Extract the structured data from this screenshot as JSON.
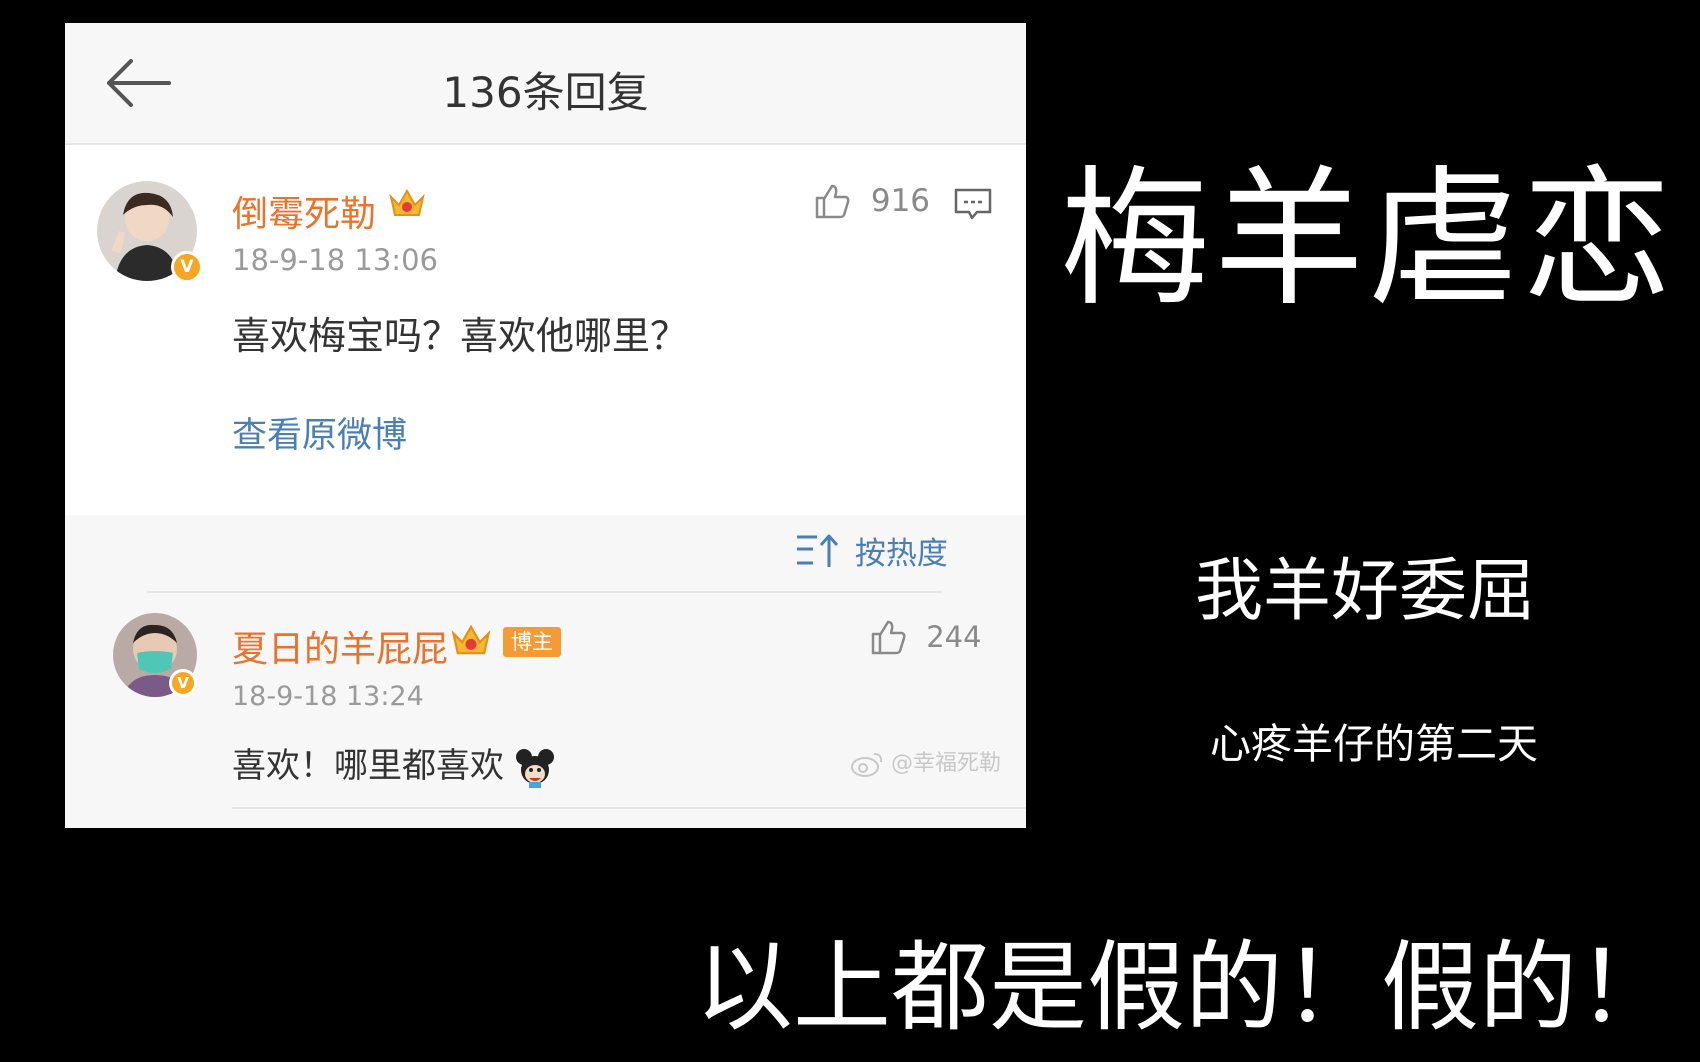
{
  "header": {
    "title": "136条回复"
  },
  "root_comment": {
    "username": "倒霉死勒",
    "time": "18-9-18 13:06",
    "text": "喜欢梅宝吗？喜欢他哪里？",
    "likes": "916",
    "view_original": "查看原微博",
    "verified_label": "V"
  },
  "sort": {
    "label": "按热度"
  },
  "replies": [
    {
      "username": "夏日的羊屁屁",
      "badge": "博主",
      "time": "18-9-18 13:24",
      "text": "喜欢！哪里都喜欢",
      "likes": "244",
      "verified_label": "V"
    }
  ],
  "watermark": "@幸福死勒",
  "captions": {
    "main": "梅羊虐恋",
    "sub": "我羊好委屈",
    "small": "心疼羊仔的第二天",
    "bottom": "以上都是假的！假的！"
  },
  "colors": {
    "username": "#e8732c",
    "link": "#4a7fb5",
    "background": "#000000"
  }
}
